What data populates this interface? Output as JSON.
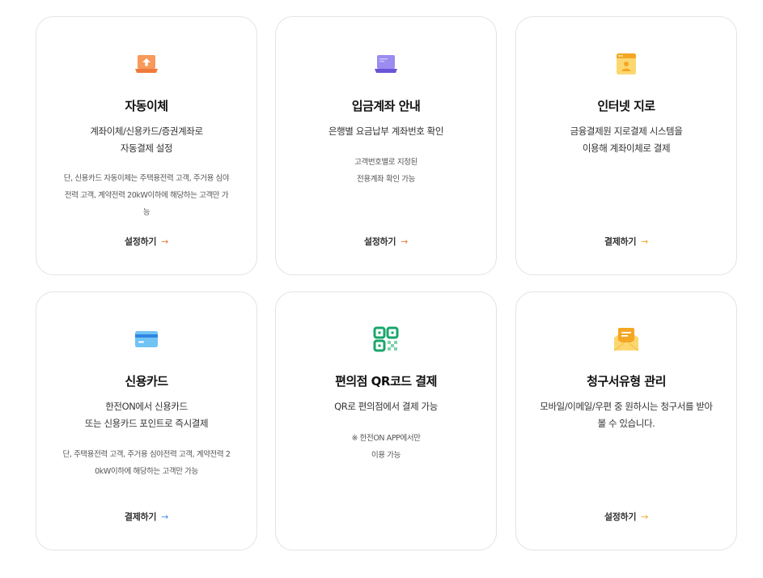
{
  "cards": [
    {
      "title": "자동이체",
      "desc": [
        "계좌이체/신용카드/증권계좌로",
        "자동결제 설정"
      ],
      "note": [
        "단, 신용카드 자동이체는 주택용전력 고객, 주거용 심야",
        "전력 고객, 계약전력 20kW이하에 해당하는 고객만 가",
        "능"
      ],
      "action": "설정하기",
      "arrow": "→",
      "icon": "laptop-upload-icon",
      "accent": "#f07a3a"
    },
    {
      "title": "입금계좌 안내",
      "desc": [
        "은행별 요금납부 계좌번호 확인"
      ],
      "note": [
        "고객번호별로 지정된",
        "전용계좌 확인 가능"
      ],
      "action": "설정하기",
      "arrow": "→",
      "icon": "laptop-icon",
      "accent": "#f07a3a"
    },
    {
      "title": "인터넷 지로",
      "desc": [
        "금융결제원 지로결제 시스템을",
        "이용해 계좌이체로 결제"
      ],
      "note": [],
      "action": "결제하기",
      "arrow": "→",
      "icon": "browser-user-icon",
      "accent": "#f5a623"
    },
    {
      "title": "신용카드",
      "desc": [
        "한전ON에서 신용카드",
        "또는 신용카드 포인트로 즉시결제"
      ],
      "note": [
        "단, 주택용전력 고객, 주거용 심야전력 고객, 계약전력 2",
        "0kW이하에 해당하는 고객만 가능"
      ],
      "action": "결제하기",
      "arrow": "→",
      "icon": "credit-card-icon",
      "accent": "#3d8fe8"
    },
    {
      "title": "편의점 QR코드 결제",
      "desc": [
        "QR로 편의점에서 결제 가능"
      ],
      "note": [
        "※ 한전ON APP에서만",
        "이용 가능"
      ],
      "action": "",
      "arrow": "",
      "icon": "qr-code-icon",
      "accent": "#1aa66b"
    },
    {
      "title": "청구서유형 관리",
      "desc": [
        "모바일/이메일/우편 중 원하시는 청구서를 받아",
        "볼 수 있습니다."
      ],
      "note": [],
      "action": "설정하기",
      "arrow": "→",
      "icon": "envelope-bill-icon",
      "accent": "#f5a623"
    }
  ]
}
